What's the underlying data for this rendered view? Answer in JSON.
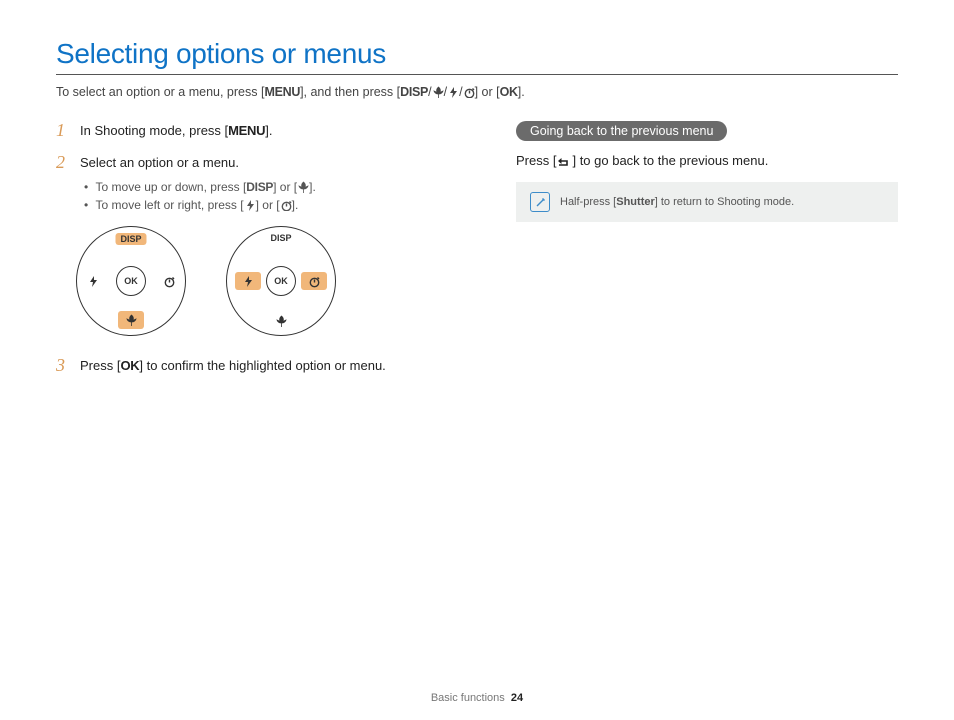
{
  "title": "Selecting options or menus",
  "intro": {
    "pre": "To select an option or a menu, press [",
    "menu": "MENU",
    "mid": "], and then press [",
    "disp": "DISP",
    "sep1": "/",
    "sep2": "/",
    "sep3": "/",
    "end1": "] or [",
    "ok": "OK",
    "end2": "]."
  },
  "steps": {
    "s1": {
      "num": "1",
      "pre": "In Shooting mode, press [",
      "menu": "MENU",
      "post": "]."
    },
    "s2": {
      "num": "2",
      "text": "Select an option or a menu.",
      "b1": {
        "pre": "To move up or down, press [",
        "disp": "DISP",
        "mid": "] or [",
        "post": "]."
      },
      "b2": {
        "pre": "To move left or right, press [",
        "mid": "] or [",
        "post": "]."
      }
    },
    "s3": {
      "num": "3",
      "pre": "Press [",
      "ok": "OK",
      "post": "] to confirm the highlighted option or menu."
    }
  },
  "dial": {
    "disp": "DISP",
    "ok": "OK"
  },
  "right": {
    "pill": "Going back to the previous menu",
    "instr": {
      "pre": "Press [",
      "post": "] to go back to the previous menu."
    },
    "note": {
      "pre": "Half-press [",
      "shutter": "Shutter",
      "post": "] to return to Shooting mode."
    }
  },
  "footer": {
    "section": "Basic functions",
    "page": "24"
  }
}
